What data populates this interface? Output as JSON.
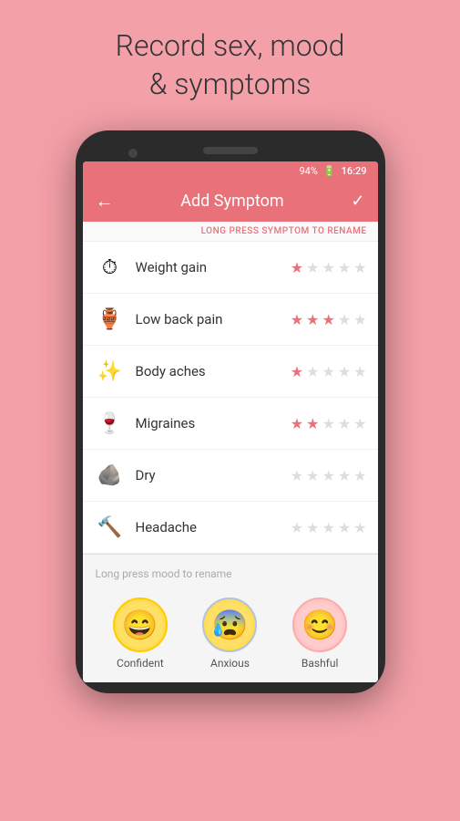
{
  "page": {
    "title_line1": "Record sex, mood",
    "title_line2": "& symptoms"
  },
  "statusBar": {
    "battery": "94%",
    "time": "16:29"
  },
  "header": {
    "back_label": "←",
    "title": "Add Symptom",
    "confirm_label": "✓"
  },
  "rename_hint": "LONG PRESS SYMPTOM TO RENAME",
  "symptoms": [
    {
      "id": "weight-gain",
      "icon": "⏱",
      "name": "Weight gain",
      "rating": 1,
      "max": 5
    },
    {
      "id": "low-back-pain",
      "icon": "🏺",
      "name": "Low back pain",
      "rating": 3,
      "max": 5
    },
    {
      "id": "body-aches",
      "icon": "✨",
      "name": "Body aches",
      "rating": 1,
      "max": 5
    },
    {
      "id": "migraines",
      "icon": "🍷",
      "name": "Migraines",
      "rating": 2,
      "max": 5
    },
    {
      "id": "dry",
      "icon": "🪨",
      "name": "Dry",
      "rating": 0,
      "max": 5
    },
    {
      "id": "headache",
      "icon": "🔨",
      "name": "Headache",
      "rating": 0,
      "max": 5
    }
  ],
  "mood_section": {
    "hint": "Long press mood to rename",
    "moods": [
      {
        "id": "confident",
        "label": "Confident",
        "emoji": "😄"
      },
      {
        "id": "anxious",
        "label": "Anxious",
        "emoji": "😰"
      },
      {
        "id": "bashful",
        "label": "Bashful",
        "emoji": "😊"
      }
    ]
  }
}
